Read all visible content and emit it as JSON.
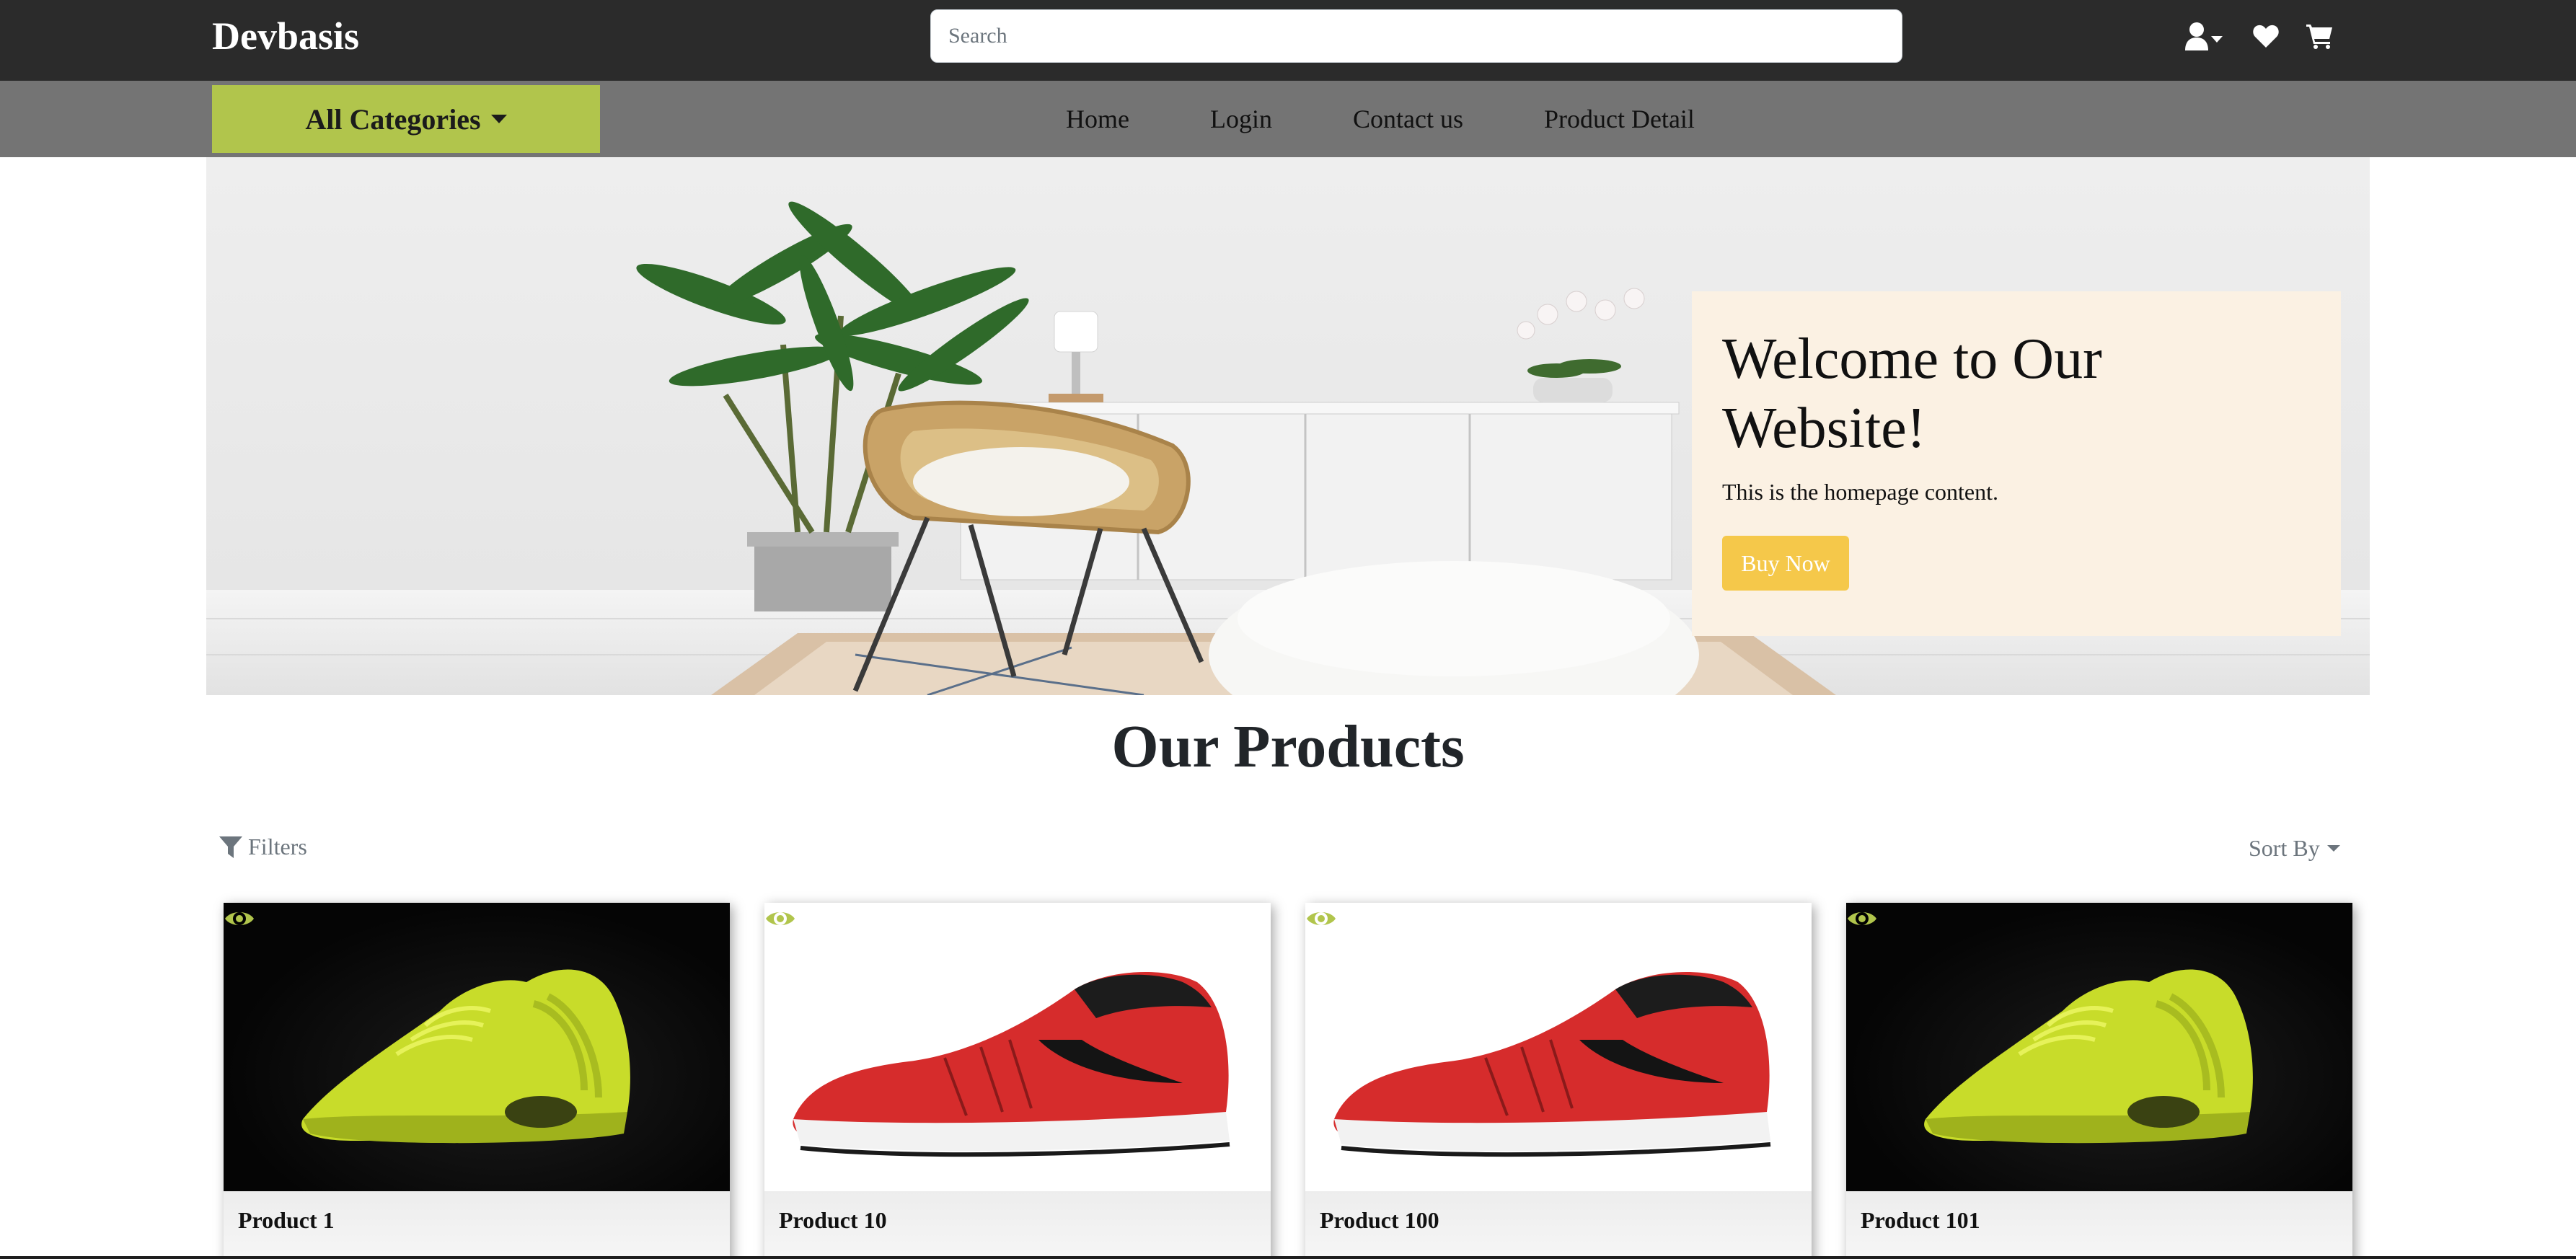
{
  "header": {
    "brand": "Devbasis",
    "search_placeholder": "Search",
    "icons": [
      "user-dropdown-icon",
      "heart-icon",
      "cart-icon"
    ]
  },
  "nav": {
    "categories_label": "All Categories",
    "links": [
      "Home",
      "Login",
      "Contact us",
      "Product Detail"
    ]
  },
  "hero": {
    "title": "Welcome to Our Website!",
    "text": "This is the homepage content.",
    "button": "Buy Now"
  },
  "products": {
    "title": "Our Products",
    "filters_label": "Filters",
    "sort_label": "Sort By",
    "items": [
      {
        "name": "Product 1",
        "image": "yellow-sneaker"
      },
      {
        "name": "Product 10",
        "image": "red-sneaker"
      },
      {
        "name": "Product 100",
        "image": "red-sneaker"
      },
      {
        "name": "Product 101",
        "image": "yellow-sneaker"
      }
    ]
  },
  "colors": {
    "topbar": "#2b2b2b",
    "navbar": "#747474",
    "accent": "#b1c54c",
    "button": "#f5c84a",
    "hero_card": "#fbf1e3"
  }
}
